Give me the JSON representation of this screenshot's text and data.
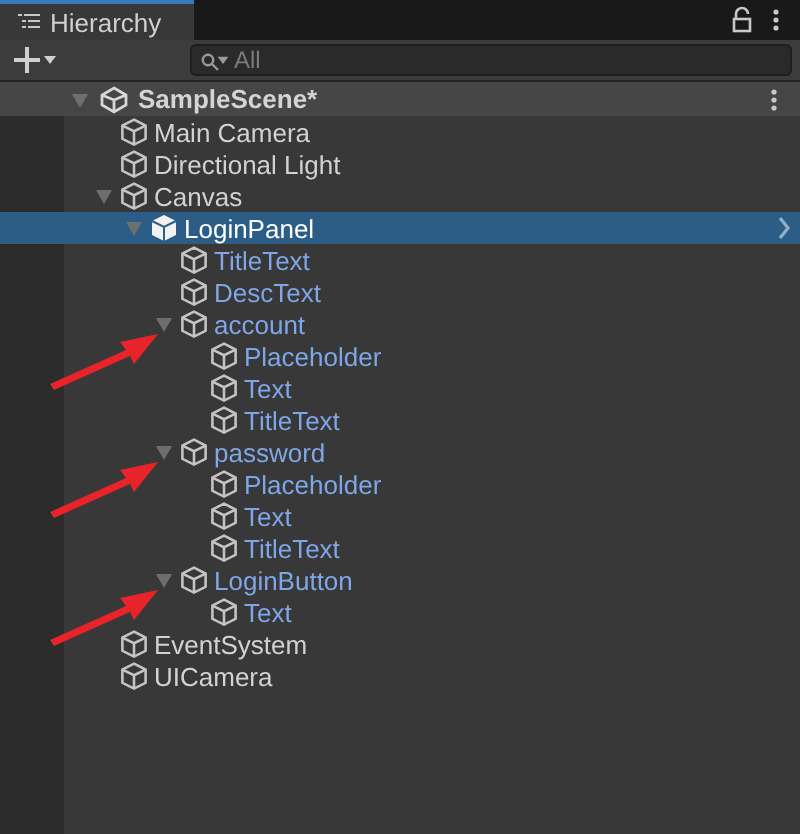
{
  "tab": {
    "title": "Hierarchy"
  },
  "search": {
    "placeholder": "All"
  },
  "scene": {
    "name": "SampleScene*",
    "expanded": true,
    "children": [
      {
        "name": "Main Camera",
        "prefab": false,
        "selected": false,
        "marked": false
      },
      {
        "name": "Directional Light",
        "prefab": false,
        "selected": false,
        "marked": false
      },
      {
        "name": "Canvas",
        "prefab": false,
        "selected": false,
        "marked": false,
        "expanded": true,
        "children": [
          {
            "name": "LoginPanel",
            "prefab": true,
            "selected": true,
            "marked": false,
            "expanded": true,
            "children": [
              {
                "name": "TitleText",
                "prefab": true,
                "selected": false,
                "marked": false
              },
              {
                "name": "DescText",
                "prefab": true,
                "selected": false,
                "marked": false
              },
              {
                "name": "account",
                "prefab": true,
                "selected": false,
                "marked": true,
                "expanded": true,
                "children": [
                  {
                    "name": "Placeholder",
                    "prefab": true,
                    "selected": false,
                    "marked": false
                  },
                  {
                    "name": "Text",
                    "prefab": true,
                    "selected": false,
                    "marked": false
                  },
                  {
                    "name": "TitleText",
                    "prefab": true,
                    "selected": false,
                    "marked": false
                  }
                ]
              },
              {
                "name": "password",
                "prefab": true,
                "selected": false,
                "marked": true,
                "expanded": true,
                "children": [
                  {
                    "name": "Placeholder",
                    "prefab": true,
                    "selected": false,
                    "marked": false
                  },
                  {
                    "name": "Text",
                    "prefab": true,
                    "selected": false,
                    "marked": false
                  },
                  {
                    "name": "TitleText",
                    "prefab": true,
                    "selected": false,
                    "marked": false
                  }
                ]
              },
              {
                "name": "LoginButton",
                "prefab": true,
                "selected": false,
                "marked": true,
                "expanded": true,
                "children": [
                  {
                    "name": "Text",
                    "prefab": true,
                    "selected": false,
                    "marked": false
                  }
                ]
              }
            ]
          }
        ]
      },
      {
        "name": "EventSystem",
        "prefab": false,
        "selected": false,
        "marked": false
      },
      {
        "name": "UICamera",
        "prefab": false,
        "selected": false,
        "marked": false
      }
    ]
  }
}
